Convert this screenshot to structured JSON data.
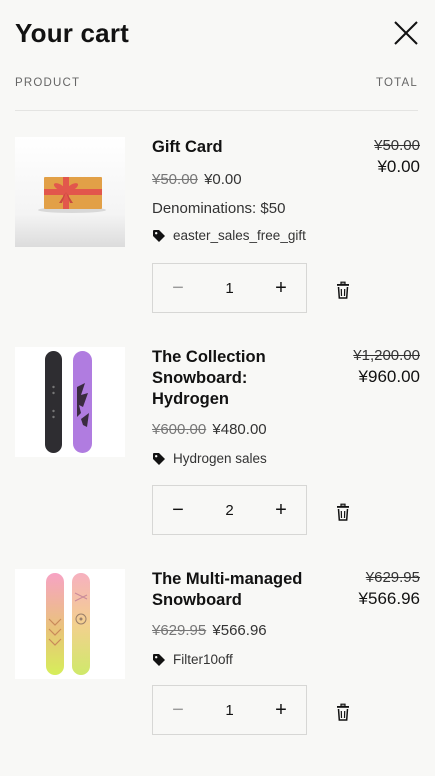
{
  "header": {
    "title": "Your cart"
  },
  "columns": {
    "product": "PRODUCT",
    "total": "TOTAL"
  },
  "items": [
    {
      "name": "Gift Card",
      "original_price": "¥50.00",
      "sale_price": "¥0.00",
      "denominations": "Denominations: $50",
      "discount": "easter_sales_free_gift",
      "quantity": "1",
      "total_original": "¥50.00",
      "total_final": "¥0.00"
    },
    {
      "name": "The Collection Snowboard: Hydrogen",
      "original_price": "¥600.00",
      "sale_price": "¥480.00",
      "discount": "Hydrogen sales",
      "quantity": "2",
      "total_original": "¥1,200.00",
      "total_final": "¥960.00"
    },
    {
      "name": "The Multi-managed Snowboard",
      "original_price": "¥629.95",
      "sale_price": "¥566.96",
      "discount": "Filter10off",
      "quantity": "1",
      "total_original": "¥629.95",
      "total_final": "¥566.96"
    }
  ],
  "icons": {
    "close": "close-icon",
    "tag": "tag-icon",
    "trash": "trash-icon",
    "minus": "minus-icon",
    "plus": "plus-icon"
  },
  "symbols": {
    "minus": "−",
    "plus": "+"
  }
}
